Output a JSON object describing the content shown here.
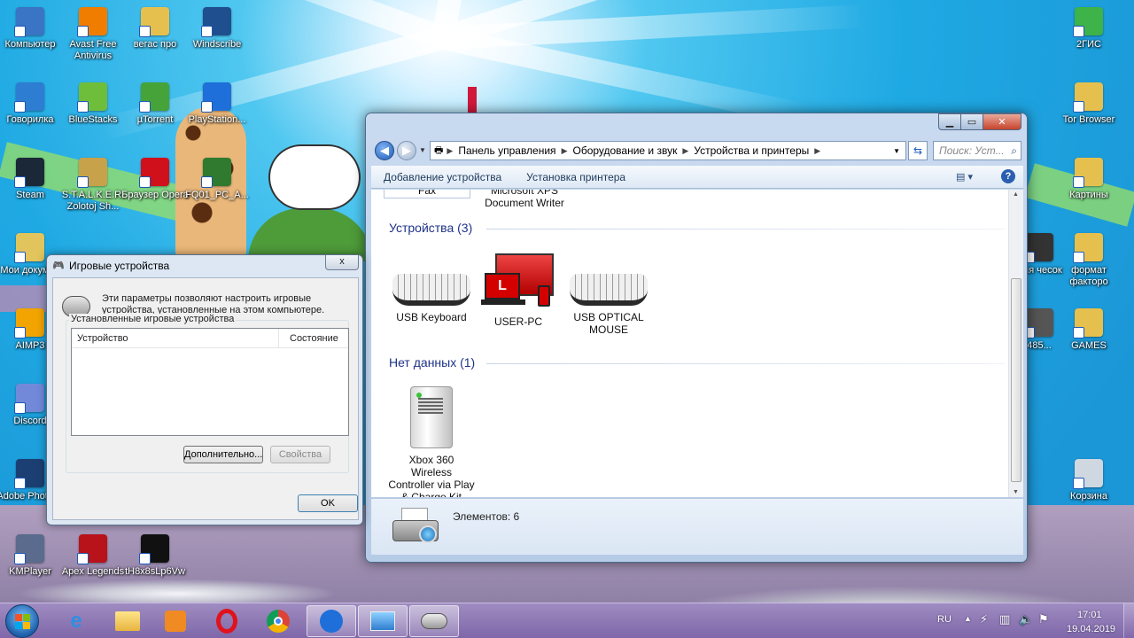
{
  "desktop": {
    "icons_left": [
      {
        "label": "Компьютер",
        "color": "#3a74c4"
      },
      {
        "label": "Avast Free Antivirus",
        "color": "#f07d00"
      },
      {
        "label": "вегас про",
        "color": "#e6c04f"
      },
      {
        "label": "Windscribe",
        "color": "#1f4f8f"
      },
      {
        "label": "Говорилка",
        "color": "#2d7dd2"
      },
      {
        "label": "BlueStacks",
        "color": "#6fbe3b"
      },
      {
        "label": "µTorrent",
        "color": "#46a33a"
      },
      {
        "label": "PlayStation...",
        "color": "#1e6fd9"
      },
      {
        "label": "Steam",
        "color": "#1b2838"
      },
      {
        "label": "S.T.A.L.K.E.R. Zolotoj Sh...",
        "color": "#c8a24a"
      },
      {
        "label": "Браузер Opera",
        "color": "#d0101b"
      },
      {
        "label": "FQ01_PC_A...",
        "color": "#2f7a2f"
      },
      {
        "label": "Мои докумен",
        "color": "#e2c45c"
      },
      {
        "label": "AIMP3",
        "color": "#f2a400"
      },
      {
        "label": "Discord",
        "color": "#7289da"
      },
      {
        "label": "Adobe Photosh",
        "color": "#1c3f73"
      },
      {
        "label": "KMPlayer",
        "color": "#5a6b8d"
      },
      {
        "label": "Apex Legends",
        "color": "#b8121b"
      },
      {
        "label": "tH8x8sLp6Vw",
        "color": "#111111"
      }
    ],
    "icons_right": [
      {
        "label": "2ГИС",
        "color": "#3db34a"
      },
      {
        "label": "Tor Browser",
        "color": "#e6c04f"
      },
      {
        "label": "Картины",
        "color": "#e6c04f"
      },
      {
        "label": "Для чесок",
        "color": "#333333"
      },
      {
        "label": "формат факторо",
        "color": "#e6c04f"
      },
      {
        "label": "485...",
        "color": "#555555"
      },
      {
        "label": "GAMES",
        "color": "#e6c04f"
      },
      {
        "label": "Корзина",
        "color": "#cfd8e0"
      }
    ]
  },
  "explorer": {
    "nav": {
      "back": "back",
      "forward": "forward"
    },
    "breadcrumb": [
      "Панель управления",
      "Оборудование и звук",
      "Устройства и принтеры"
    ],
    "search_placeholder": "Поиск: Уст...",
    "toolbar": {
      "add_device": "Добавление устройства",
      "add_printer": "Установка принтера"
    },
    "partial_items": {
      "fax": "Fax",
      "xps": "Microsoft XPS Document Writer"
    },
    "groups": [
      {
        "title": "Устройства (3)",
        "items": [
          "USB Keyboard",
          "USER-PC",
          "USB OPTICAL MOUSE"
        ]
      },
      {
        "title": "Нет данных (1)",
        "items": [
          "Xbox 360 Wireless Controller via Play & Charge Kit"
        ]
      }
    ],
    "status": "Элементов: 6"
  },
  "dialog": {
    "title": "Игровые устройства",
    "description": "Эти параметры позволяют настроить игровые устройства, установленные на этом компьютере.",
    "group_label": "Установленные игровые устройства",
    "columns": [
      "Устройство",
      "Состояние"
    ],
    "advanced_button": "Дополнительно...",
    "properties_button": "Свойства",
    "ok_button": "OK",
    "close": "x"
  },
  "taskbar": {
    "language": "RU",
    "time": "17:01",
    "date": "19.04.2019",
    "accent": "#8b73b3"
  }
}
